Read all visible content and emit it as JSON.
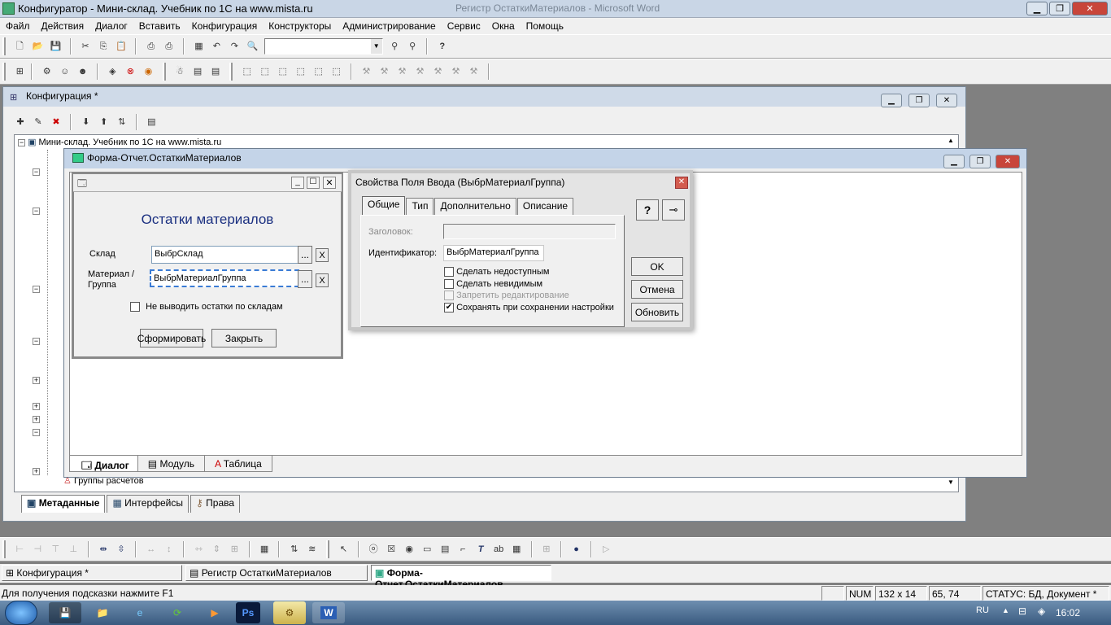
{
  "app": {
    "title": "Конфигуратор - Мини-склад. Учебник по 1С на www.mista.ru",
    "bg_title": "Регистр ОстаткиМатериалов - Microsoft Word"
  },
  "menu": [
    "Файл",
    "Действия",
    "Диалог",
    "Вставить",
    "Конфигурация",
    "Конструкторы",
    "Администрирование",
    "Сервис",
    "Окна",
    "Помощь"
  ],
  "config_window": {
    "title": "Конфигурация *",
    "tree_root": "Мини-склад. Учебник по 1С на www.mista.ru",
    "tree_last": "Группы расчетов",
    "tabs": [
      "Метаданные",
      "Интерфейсы",
      "Права"
    ]
  },
  "form_window": {
    "title": "Форма-Отчет.ОстаткиМатериалов",
    "bottom_tabs": [
      "Диалог",
      "Модуль",
      "Таблица"
    ]
  },
  "dialog": {
    "heading": "Остатки материалов",
    "label_sklad": "Склад",
    "value_sklad": "ВыбрСклад",
    "label_material": "Материал /\nГруппа",
    "value_material": "ВыбрМатериалГруппа",
    "dots": "...",
    "clear": "X",
    "checkbox": "Не выводить остатки по складам",
    "btn_form": "Сформировать",
    "btn_close": "Закрыть"
  },
  "props": {
    "title": "Свойства  Поля Ввода (ВыбрМатериалГруппа)",
    "tabs": [
      "Общие",
      "Тип",
      "Дополнительно",
      "Описание"
    ],
    "label_header": "Заголовок:",
    "label_id": "Идентификатор:",
    "id_value": "ВыбрМатериалГруппа",
    "checks": [
      {
        "label": "Сделать недоступным",
        "checked": false,
        "enabled": true
      },
      {
        "label": "Сделать невидимым",
        "checked": false,
        "enabled": true
      },
      {
        "label": "Запретить редактирование",
        "checked": false,
        "enabled": false
      },
      {
        "label": "Сохранять при сохранении настройки",
        "checked": true,
        "enabled": true
      }
    ],
    "btn_ok": "OK",
    "btn_cancel": "Отмена",
    "btn_refresh": "Обновить",
    "help_icon": "?"
  },
  "window_tabs": [
    "Конфигурация *",
    "Регистр ОстаткиМатериалов",
    "Форма-Отчет.ОстаткиМатериалов"
  ],
  "status": {
    "hint": "Для получения подсказки нажмите F1",
    "num": "NUM",
    "size": "132 x 14",
    "pos": "65, 74",
    "state": "СТАТУС: БД, Документ *"
  },
  "taskbar": {
    "lang": "RU",
    "time": "16:02",
    "ps": "Ps",
    "word": "W"
  }
}
